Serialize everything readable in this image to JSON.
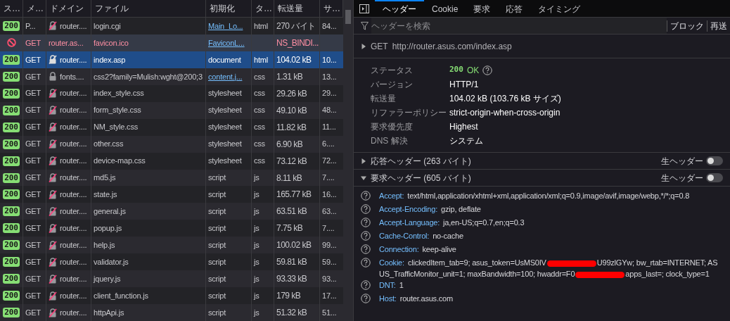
{
  "request_table": {
    "columns": [
      "ス…",
      "メ…",
      "ドメイン",
      "ファイル",
      "初期化",
      "タ…",
      "転送量",
      "サ…"
    ],
    "rows": [
      {
        "status": "200",
        "kind": "insecure",
        "selected": false,
        "method": "P...",
        "domain": "router....",
        "file": "login.cgi",
        "initiator": "Main_Lo...",
        "initiator_link": true,
        "type": "html",
        "transferred": "270 バイト",
        "size": "84..."
      },
      {
        "kind": "blocked",
        "selected": false,
        "method": "GET",
        "domain": "router.as...",
        "file": "favicon.ico",
        "initiator": "FaviconL...",
        "initiator_link": true,
        "transferred": "NS_BINDI..."
      },
      {
        "status": "200",
        "kind": "insecure",
        "selected": true,
        "method": "GET",
        "domain": "router....",
        "file": "index.asp",
        "initiator": "document",
        "initiator_link": false,
        "type": "html",
        "transferred": "104.02 kB",
        "size": "10..."
      },
      {
        "status": "200",
        "kind": "secure",
        "selected": false,
        "method": "GET",
        "domain": "fonts....",
        "file": "css2?family=Mulish:wght@200;3",
        "initiator": "content.j...",
        "initiator_link": true,
        "type": "css",
        "transferred": "1.31 kB",
        "size": "13..."
      },
      {
        "status": "200",
        "kind": "insecure",
        "selected": false,
        "method": "GET",
        "domain": "router....",
        "file": "index_style.css",
        "initiator": "stylesheet",
        "initiator_link": false,
        "type": "css",
        "transferred": "29.26 kB",
        "size": "29..."
      },
      {
        "status": "200",
        "kind": "insecure",
        "selected": false,
        "method": "GET",
        "domain": "router....",
        "file": "form_style.css",
        "initiator": "stylesheet",
        "initiator_link": false,
        "type": "css",
        "transferred": "49.10 kB",
        "size": "48..."
      },
      {
        "status": "200",
        "kind": "insecure",
        "selected": false,
        "method": "GET",
        "domain": "router....",
        "file": "NM_style.css",
        "initiator": "stylesheet",
        "initiator_link": false,
        "type": "css",
        "transferred": "11.82 kB",
        "size": "11..."
      },
      {
        "status": "200",
        "kind": "insecure",
        "selected": false,
        "method": "GET",
        "domain": "router....",
        "file": "other.css",
        "initiator": "stylesheet",
        "initiator_link": false,
        "type": "css",
        "transferred": "6.90 kB",
        "size": "6...."
      },
      {
        "status": "200",
        "kind": "insecure",
        "selected": false,
        "method": "GET",
        "domain": "router....",
        "file": "device-map.css",
        "initiator": "stylesheet",
        "initiator_link": false,
        "type": "css",
        "transferred": "73.12 kB",
        "size": "72..."
      },
      {
        "status": "200",
        "kind": "insecure",
        "selected": false,
        "method": "GET",
        "domain": "router....",
        "file": "md5.js",
        "initiator": "script",
        "initiator_link": false,
        "type": "js",
        "transferred": "8.11 kB",
        "size": "7...."
      },
      {
        "status": "200",
        "kind": "insecure",
        "selected": false,
        "method": "GET",
        "domain": "router....",
        "file": "state.js",
        "initiator": "script",
        "initiator_link": false,
        "type": "js",
        "transferred": "165.77 kB",
        "size": "16..."
      },
      {
        "status": "200",
        "kind": "insecure",
        "selected": false,
        "method": "GET",
        "domain": "router....",
        "file": "general.js",
        "initiator": "script",
        "initiator_link": false,
        "type": "js",
        "transferred": "63.51 kB",
        "size": "63..."
      },
      {
        "status": "200",
        "kind": "insecure",
        "selected": false,
        "method": "GET",
        "domain": "router....",
        "file": "popup.js",
        "initiator": "script",
        "initiator_link": false,
        "type": "js",
        "transferred": "7.75 kB",
        "size": "7...."
      },
      {
        "status": "200",
        "kind": "insecure",
        "selected": false,
        "method": "GET",
        "domain": "router....",
        "file": "help.js",
        "initiator": "script",
        "initiator_link": false,
        "type": "js",
        "transferred": "100.02 kB",
        "size": "99..."
      },
      {
        "status": "200",
        "kind": "insecure",
        "selected": false,
        "method": "GET",
        "domain": "router....",
        "file": "validator.js",
        "initiator": "script",
        "initiator_link": false,
        "type": "js",
        "transferred": "59.81 kB",
        "size": "59..."
      },
      {
        "status": "200",
        "kind": "insecure",
        "selected": false,
        "method": "GET",
        "domain": "router....",
        "file": "jquery.js",
        "initiator": "script",
        "initiator_link": false,
        "type": "js",
        "transferred": "93.33 kB",
        "size": "93..."
      },
      {
        "status": "200",
        "kind": "insecure",
        "selected": false,
        "method": "GET",
        "domain": "router....",
        "file": "client_function.js",
        "initiator": "script",
        "initiator_link": false,
        "type": "js",
        "transferred": "179 kB",
        "size": "17..."
      },
      {
        "status": "200",
        "kind": "insecure",
        "selected": false,
        "method": "GET",
        "domain": "router....",
        "file": "httpApi.js",
        "initiator": "script",
        "initiator_link": false,
        "type": "js",
        "transferred": "51.32 kB",
        "size": "51..."
      }
    ]
  },
  "details": {
    "tabs": [
      {
        "label": "ヘッダー",
        "selected": true
      },
      {
        "label": "Cookie",
        "selected": false
      },
      {
        "label": "要求",
        "selected": false
      },
      {
        "label": "応答",
        "selected": false
      },
      {
        "label": "タイミング",
        "selected": false
      }
    ],
    "filter": {
      "placeholder": "ヘッダーを検索"
    },
    "actions": [
      "ブロック",
      "再送"
    ],
    "request_line": {
      "expanded": false,
      "method": "GET",
      "url": "http://router.asus.com/index.asp"
    },
    "summary": [
      {
        "label": "ステータス",
        "kind": "status",
        "code": "200",
        "value": "OK"
      },
      {
        "label": "バージョン",
        "kind": "text",
        "value": "HTTP/1"
      },
      {
        "label": "転送量",
        "kind": "text",
        "value": "104.02 kB (103.76 kB サイズ)"
      },
      {
        "label": "リファラーポリシー",
        "kind": "text",
        "value": "strict-origin-when-cross-origin"
      },
      {
        "label": "要求優先度",
        "kind": "text",
        "value": "Highest"
      },
      {
        "label": "DNS 解決",
        "kind": "text",
        "value": "システム"
      }
    ],
    "sections": [
      {
        "title": "応答ヘッダー (263 バイト)",
        "expanded": false,
        "raw_label": "生ヘッダー",
        "raw_on": false
      },
      {
        "title": "要求ヘッダー (605 バイト)",
        "expanded": true,
        "raw_label": "生ヘッダー",
        "raw_on": false,
        "headers": [
          {
            "name": "Accept:",
            "parts": [
              {
                "kind": "text",
                "text": "text/html,application/xhtml+xml,application/xml;q=0.9,image/avif,image/webp,*/*;q=0.8"
              }
            ]
          },
          {
            "name": "Accept-Encoding:",
            "parts": [
              {
                "kind": "text",
                "text": "gzip, deflate"
              }
            ]
          },
          {
            "name": "Accept-Language:",
            "parts": [
              {
                "kind": "text",
                "text": "ja,en-US;q=0.7,en;q=0.3"
              }
            ]
          },
          {
            "name": "Cache-Control:",
            "parts": [
              {
                "kind": "text",
                "text": "no-cache"
              }
            ]
          },
          {
            "name": "Connection:",
            "parts": [
              {
                "kind": "text",
                "text": "keep-alive"
              }
            ]
          },
          {
            "name": "Cookie:",
            "parts": [
              {
                "kind": "text",
                "text": "clickedItem_tab=9; asus_token=UsMS0IV"
              },
              {
                "kind": "redacted"
              },
              {
                "kind": "text",
                "text": "U99zlGYw; bw_rtab=INTERNET; ASUS_TrafficMonitor_unit=1; maxBandwidth=100; hwaddr=F0"
              },
              {
                "kind": "redacted"
              },
              {
                "kind": "text",
                "text": "apps_last=; clock_type=1"
              }
            ]
          },
          {
            "name": "DNT:",
            "parts": [
              {
                "kind": "text",
                "text": "1"
              }
            ]
          },
          {
            "name": "Host:",
            "parts": [
              {
                "kind": "text",
                "text": "router.asus.com"
              }
            ]
          }
        ]
      }
    ]
  }
}
